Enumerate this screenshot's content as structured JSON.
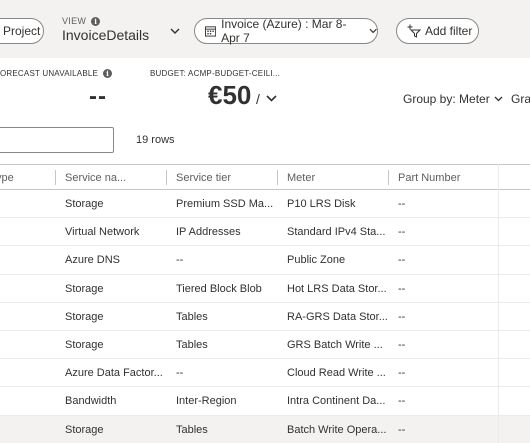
{
  "toolbar": {
    "project_label": "Project",
    "view_label": "VIEW",
    "view_value": "InvoiceDetails",
    "scope_label": "Invoice (Azure) : Mar 8-Apr 7",
    "add_filter_label": "Add filter"
  },
  "kpis": {
    "forecast_label": "ORECAST UNAVAILABLE",
    "forecast_value": "--",
    "budget_label": "BUDGET: ACMP-BUDGET-CEILI...",
    "budget_value": "€50",
    "budget_unit": "/"
  },
  "controls": {
    "group_by": "Group by: Meter",
    "granularity": "Gran",
    "rows_count": "19 rows"
  },
  "table": {
    "headers": [
      "ype",
      "Service na...",
      "Service tier",
      "Meter",
      "Part Number"
    ],
    "rows": [
      [
        "",
        "Storage",
        "Premium SSD Ma...",
        "P10 LRS Disk",
        "--"
      ],
      [
        "",
        "Virtual Network",
        "IP Addresses",
        "Standard IPv4 Sta...",
        "--"
      ],
      [
        "",
        "Azure DNS",
        "--",
        "Public Zone",
        "--"
      ],
      [
        "",
        "Storage",
        "Tiered Block Blob",
        "Hot LRS Data Stor...",
        "--"
      ],
      [
        "",
        "Storage",
        "Tables",
        "RA-GRS Data Stor...",
        "--"
      ],
      [
        "",
        "Storage",
        "Tables",
        "GRS Batch Write ...",
        "--"
      ],
      [
        "",
        "Azure Data Factor...",
        "--",
        "Cloud Read Write ...",
        "--"
      ],
      [
        "",
        "Bandwidth",
        "Inter-Region",
        "Intra Continent Da...",
        "--"
      ],
      [
        "",
        "Storage",
        "Tables",
        "Batch Write Opera...",
        "--"
      ]
    ]
  },
  "icons": [
    "info-icon",
    "chevron-down-icon",
    "calendar-icon",
    "add-filter-icon"
  ]
}
